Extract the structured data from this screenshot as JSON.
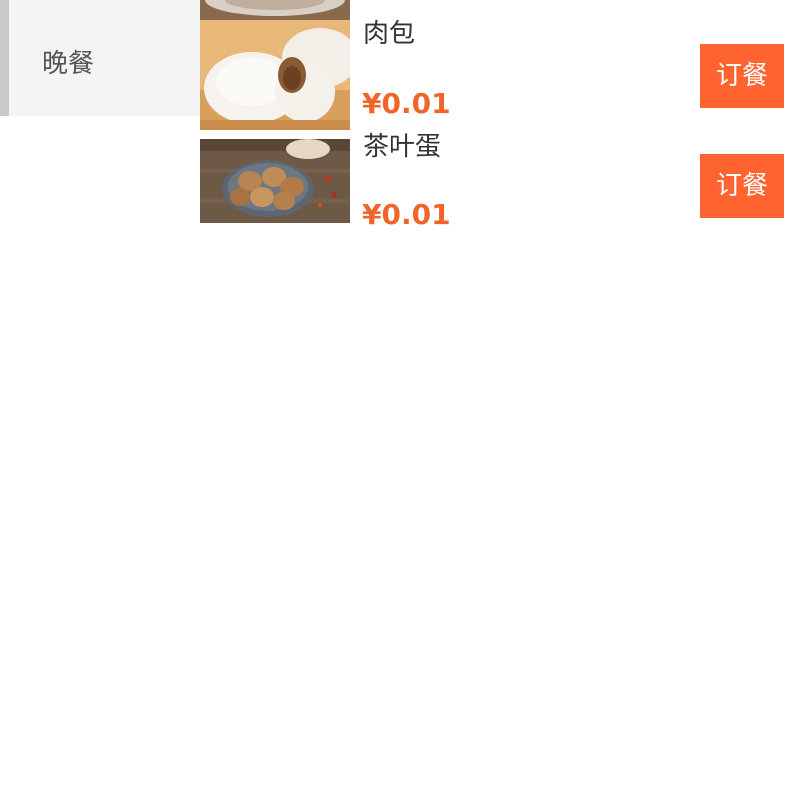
{
  "sidebar": {
    "items": [
      {
        "label": "晚餐",
        "selected": true
      }
    ]
  },
  "menu": {
    "items": [
      {
        "name": "肉包",
        "price": "¥0.01",
        "order_label": "订餐",
        "image_icon": "steamed-bun-image"
      },
      {
        "name": "茶叶蛋",
        "price": "¥0.01",
        "order_label": "订餐",
        "image_icon": "tea-egg-image"
      }
    ]
  },
  "colors": {
    "accent": "#ff6330",
    "price": "#f0652a",
    "sidebar_bg": "#f4f4f4",
    "sidebar_indicator": "#c9c9c9"
  }
}
